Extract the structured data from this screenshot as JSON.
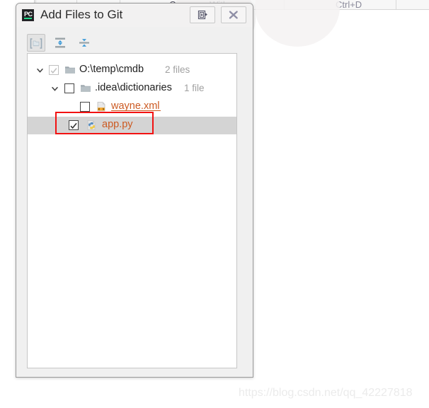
{
  "background": {
    "menu": {
      "item_label": "Compare With...",
      "shortcut": "Ctrl+D",
      "icon": "compare-icon"
    }
  },
  "dialog": {
    "title": "Add Files to Git",
    "app_icon": "pycharm-icon",
    "app_icon_text": "PC",
    "title_buttons": [
      {
        "name": "context-help-button",
        "icon": "context-help-icon",
        "label": ""
      },
      {
        "name": "close-button",
        "icon": "close-icon",
        "label": ""
      }
    ],
    "toolbar": {
      "buttons": [
        {
          "name": "group-by-directory-button",
          "icon": "folder-group-icon",
          "pressed": true,
          "label": ""
        },
        {
          "name": "expand-all-button",
          "icon": "expand-all-icon",
          "pressed": false,
          "label": ""
        },
        {
          "name": "collapse-all-button",
          "icon": "collapse-all-icon",
          "pressed": false,
          "label": ""
        }
      ]
    },
    "tree": {
      "rows": [
        {
          "label": "O:\\temp\\cmdb",
          "count": "2 files",
          "icon": "folder-icon",
          "checkbox": "partial-disabled",
          "twisty": "chevron-down-icon",
          "selected": false,
          "kind": "directory"
        },
        {
          "label": ".idea\\dictionaries",
          "count": "1 file",
          "icon": "folder-icon",
          "checkbox": "unchecked",
          "twisty": "chevron-down-icon",
          "selected": false,
          "kind": "directory"
        },
        {
          "label": "wayne.xml",
          "count": "",
          "icon": "xml-file-icon",
          "checkbox": "unchecked",
          "twisty": "",
          "selected": false,
          "kind": "file"
        },
        {
          "label": "app.py",
          "count": "",
          "icon": "python-file-icon",
          "checkbox": "checked",
          "twisty": "",
          "selected": true,
          "kind": "file"
        }
      ]
    }
  },
  "annotation": {
    "name": "red-highlight-box",
    "color": "#f21212"
  },
  "watermark": {
    "text": "https://blog.csdn.net/qq_42227818",
    "color": "#ebebeb"
  }
}
